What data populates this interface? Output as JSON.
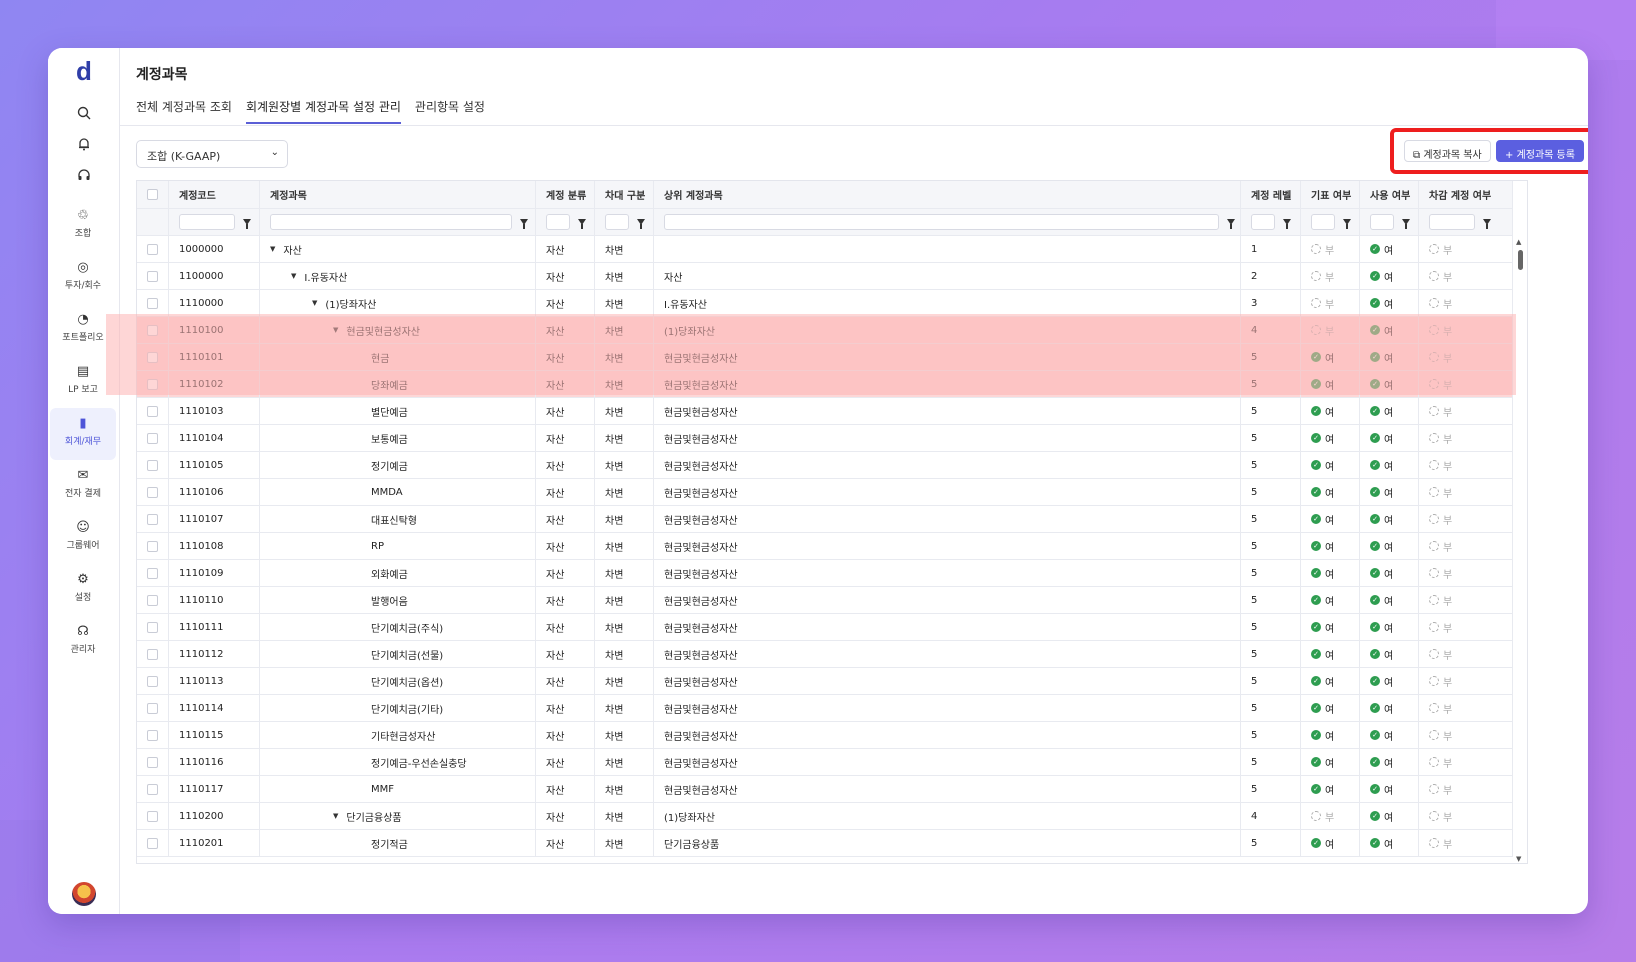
{
  "sidebar": {
    "logo": "d",
    "items": [
      {
        "label": "조합",
        "icon": "recycle-icon"
      },
      {
        "label": "투자/회수",
        "icon": "coins-icon"
      },
      {
        "label": "포트폴리오",
        "icon": "pie-chart-icon"
      },
      {
        "label": "LP 보고",
        "icon": "report-icon"
      },
      {
        "label": "회계/재무",
        "icon": "accounting-icon"
      },
      {
        "label": "전자 결제",
        "icon": "mail-icon"
      },
      {
        "label": "그룹웨어",
        "icon": "users-icon"
      },
      {
        "label": "설정",
        "icon": "gear-icon"
      },
      {
        "label": "관리자",
        "icon": "headset-icon"
      }
    ],
    "active_index": 4
  },
  "header": {
    "title": "계정과목",
    "tabs": [
      "전체 계정과목 조회",
      "회계원장별 계정과목 설정 관리",
      "관리항목 설정"
    ],
    "active_tab": 1
  },
  "toolbar": {
    "select_value": "조합 (K-GAAP)",
    "copy_label": "계정과목 복사",
    "add_label": "+ 계정과목 등록"
  },
  "table": {
    "columns": [
      "계정코드",
      "계정과목",
      "계정 분류",
      "차대 구분",
      "상위 계정과목",
      "계정 레벨",
      "기표 여부",
      "사용 여부",
      "차감 계정 여부"
    ],
    "yes_label": "여",
    "no_label": "부",
    "rows": [
      {
        "code": "1000000",
        "name": "자산",
        "cls": "자산",
        "dc": "차변",
        "parent": "",
        "level": "1",
        "slip": false,
        "use": true,
        "sub": false,
        "indent": 0,
        "caret": true
      },
      {
        "code": "1100000",
        "name": "I.유동자산",
        "cls": "자산",
        "dc": "차변",
        "parent": "자산",
        "level": "2",
        "slip": false,
        "use": true,
        "sub": false,
        "indent": 1,
        "caret": true
      },
      {
        "code": "1110000",
        "name": "(1)당좌자산",
        "cls": "자산",
        "dc": "차변",
        "parent": "I.유동자산",
        "level": "3",
        "slip": false,
        "use": true,
        "sub": false,
        "indent": 2,
        "caret": true
      },
      {
        "code": "1110100",
        "name": "현금및현금성자산",
        "cls": "자산",
        "dc": "차변",
        "parent": "(1)당좌자산",
        "level": "4",
        "slip": false,
        "use": true,
        "sub": false,
        "indent": 3,
        "caret": true,
        "hl": true
      },
      {
        "code": "1110101",
        "name": "현금",
        "cls": "자산",
        "dc": "차변",
        "parent": "현금및현금성자산",
        "level": "5",
        "slip": true,
        "use": true,
        "sub": false,
        "indent": 4,
        "hl": true
      },
      {
        "code": "1110102",
        "name": "당좌예금",
        "cls": "자산",
        "dc": "차변",
        "parent": "현금및현금성자산",
        "level": "5",
        "slip": true,
        "use": true,
        "sub": false,
        "indent": 4,
        "hl": true
      },
      {
        "code": "1110103",
        "name": "별단예금",
        "cls": "자산",
        "dc": "차변",
        "parent": "현금및현금성자산",
        "level": "5",
        "slip": true,
        "use": true,
        "sub": false,
        "indent": 4
      },
      {
        "code": "1110104",
        "name": "보통예금",
        "cls": "자산",
        "dc": "차변",
        "parent": "현금및현금성자산",
        "level": "5",
        "slip": true,
        "use": true,
        "sub": false,
        "indent": 4
      },
      {
        "code": "1110105",
        "name": "정기예금",
        "cls": "자산",
        "dc": "차변",
        "parent": "현금및현금성자산",
        "level": "5",
        "slip": true,
        "use": true,
        "sub": false,
        "indent": 4
      },
      {
        "code": "1110106",
        "name": "MMDA",
        "cls": "자산",
        "dc": "차변",
        "parent": "현금및현금성자산",
        "level": "5",
        "slip": true,
        "use": true,
        "sub": false,
        "indent": 4
      },
      {
        "code": "1110107",
        "name": "대표신탁형",
        "cls": "자산",
        "dc": "차변",
        "parent": "현금및현금성자산",
        "level": "5",
        "slip": true,
        "use": true,
        "sub": false,
        "indent": 4
      },
      {
        "code": "1110108",
        "name": "RP",
        "cls": "자산",
        "dc": "차변",
        "parent": "현금및현금성자산",
        "level": "5",
        "slip": true,
        "use": true,
        "sub": false,
        "indent": 4
      },
      {
        "code": "1110109",
        "name": "외화예금",
        "cls": "자산",
        "dc": "차변",
        "parent": "현금및현금성자산",
        "level": "5",
        "slip": true,
        "use": true,
        "sub": false,
        "indent": 4
      },
      {
        "code": "1110110",
        "name": "발행어음",
        "cls": "자산",
        "dc": "차변",
        "parent": "현금및현금성자산",
        "level": "5",
        "slip": true,
        "use": true,
        "sub": false,
        "indent": 4
      },
      {
        "code": "1110111",
        "name": "단기예치금(주식)",
        "cls": "자산",
        "dc": "차변",
        "parent": "현금및현금성자산",
        "level": "5",
        "slip": true,
        "use": true,
        "sub": false,
        "indent": 4
      },
      {
        "code": "1110112",
        "name": "단기예치금(선물)",
        "cls": "자산",
        "dc": "차변",
        "parent": "현금및현금성자산",
        "level": "5",
        "slip": true,
        "use": true,
        "sub": false,
        "indent": 4
      },
      {
        "code": "1110113",
        "name": "단기예치금(옵션)",
        "cls": "자산",
        "dc": "차변",
        "parent": "현금및현금성자산",
        "level": "5",
        "slip": true,
        "use": true,
        "sub": false,
        "indent": 4
      },
      {
        "code": "1110114",
        "name": "단기예치금(기타)",
        "cls": "자산",
        "dc": "차변",
        "parent": "현금및현금성자산",
        "level": "5",
        "slip": true,
        "use": true,
        "sub": false,
        "indent": 4
      },
      {
        "code": "1110115",
        "name": "기타현금성자산",
        "cls": "자산",
        "dc": "차변",
        "parent": "현금및현금성자산",
        "level": "5",
        "slip": true,
        "use": true,
        "sub": false,
        "indent": 4
      },
      {
        "code": "1110116",
        "name": "정기예금-우선손실충당",
        "cls": "자산",
        "dc": "차변",
        "parent": "현금및현금성자산",
        "level": "5",
        "slip": true,
        "use": true,
        "sub": false,
        "indent": 4
      },
      {
        "code": "1110117",
        "name": "MMF",
        "cls": "자산",
        "dc": "차변",
        "parent": "현금및현금성자산",
        "level": "5",
        "slip": true,
        "use": true,
        "sub": false,
        "indent": 4
      },
      {
        "code": "1110200",
        "name": "단기금융상품",
        "cls": "자산",
        "dc": "차변",
        "parent": "(1)당좌자산",
        "level": "4",
        "slip": false,
        "use": true,
        "sub": false,
        "indent": 3,
        "caret": true
      },
      {
        "code": "1110201",
        "name": "정기적금",
        "cls": "자산",
        "dc": "차변",
        "parent": "단기금융상품",
        "level": "5",
        "slip": true,
        "use": true,
        "sub": false,
        "indent": 4
      }
    ]
  },
  "colors": {
    "accent": "#5b5fe0",
    "highlight": "#ee1e1e",
    "yes": "#2e9d50",
    "row_highlight": "#fdd7d7"
  }
}
